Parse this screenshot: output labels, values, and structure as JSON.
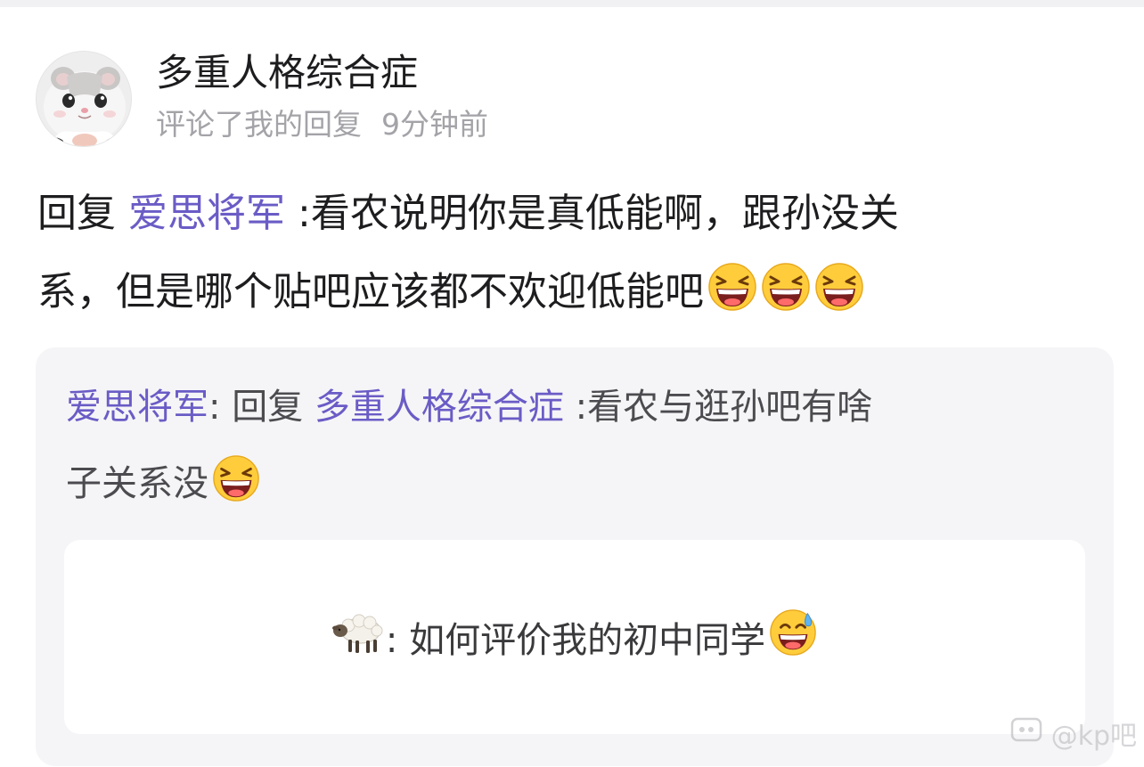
{
  "user": {
    "name": "多重人格综合症",
    "action": "评论了我的回复",
    "time": "9分钟前"
  },
  "comment": {
    "reply_prefix": "回复",
    "mention": "爱思将军",
    "line1_text": ":看农说明你是真低能啊，跟孙没关",
    "line2_text": "系，但是哪个贴吧应该都不欢迎低能吧",
    "emoji_icons": [
      "grinning-squint-face-icon",
      "grinning-squint-face-icon",
      "grinning-squint-face-icon"
    ]
  },
  "quote": {
    "author": "爱思将军",
    "separator": ": ",
    "reply_prefix": "回复",
    "mention": "多重人格综合症",
    "line1_text": ":看农与逛孙吧有啥",
    "line2_text": "子关系没",
    "emoji_icon": "grinning-squint-face-icon"
  },
  "original_post": {
    "prefix_icon": "sheep-icon",
    "text": ": 如何评价我的初中同学",
    "suffix_icon": "grinning-sweat-face-icon"
  },
  "watermark": {
    "text": "@kp吧"
  },
  "colors": {
    "mention": "#6a5cc6",
    "primary_text": "#1d1d1f",
    "meta_text": "#a3a3a8",
    "quote_bg": "#f5f5f7"
  }
}
